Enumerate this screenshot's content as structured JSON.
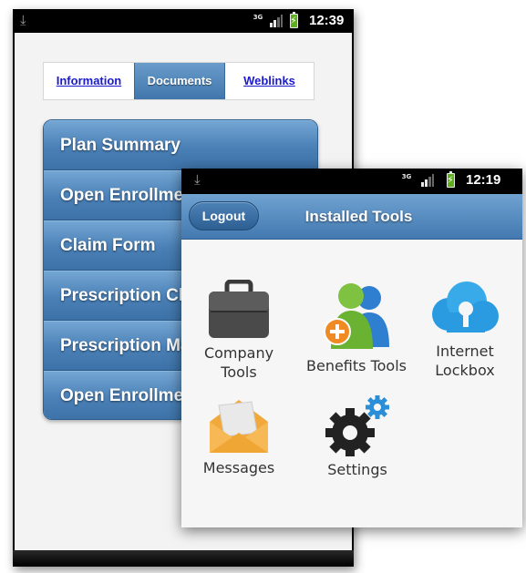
{
  "back_screen": {
    "status_bar": {
      "time": "12:39",
      "network": "3G"
    },
    "tabs": [
      {
        "label": "Information",
        "active": false
      },
      {
        "label": "Documents",
        "active": true
      },
      {
        "label": "Weblinks",
        "active": false
      }
    ],
    "documents": [
      {
        "label": "Plan Summary"
      },
      {
        "label": "Open Enrollment"
      },
      {
        "label": "Claim Form"
      },
      {
        "label": "Prescription Claim Form"
      },
      {
        "label": "Prescription Mail Order"
      },
      {
        "label": "Open Enrollment"
      }
    ]
  },
  "front_screen": {
    "status_bar": {
      "time": "12:19",
      "network": "3G"
    },
    "header": {
      "logout_label": "Logout",
      "title": "Installed Tools"
    },
    "tools": [
      {
        "label": "Company\nTools",
        "icon": "briefcase-icon"
      },
      {
        "label": "Benefits Tools",
        "icon": "people-add-icon"
      },
      {
        "label": "Internet\nLockbox",
        "icon": "cloud-lock-icon"
      },
      {
        "label": "Messages",
        "icon": "envelope-icon"
      },
      {
        "label": "Settings",
        "icon": "gears-icon"
      }
    ]
  },
  "colors": {
    "accent_blue": "#4a80b6",
    "battery_green": "#5fae1d",
    "link_blue": "#1a1acc"
  }
}
